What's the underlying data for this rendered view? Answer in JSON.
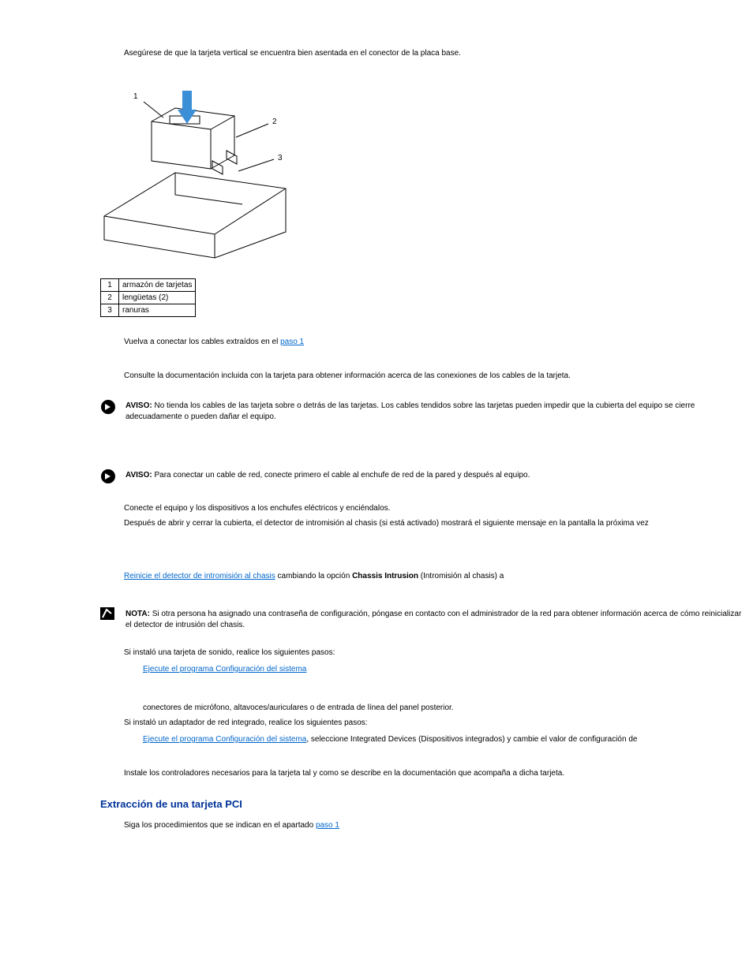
{
  "step_asegurese": "Asegúrese de que la tarjeta vertical se encuentra bien asentada en el conector de la placa base.",
  "diagram_labels": {
    "n1": "1",
    "n2": "2",
    "n3": "3"
  },
  "callouts": {
    "r1": {
      "num": "1",
      "label": "armazón de tarjetas"
    },
    "r2": {
      "num": "2",
      "label": "lengüetas (2)"
    },
    "r3": {
      "num": "3",
      "label": "ranuras"
    }
  },
  "reconnect": {
    "pre": "Vuelva a conectar los cables extraídos en el ",
    "link": "paso 1"
  },
  "consulte": "Consulte la documentación incluida con la tarjeta para obtener información acerca de las conexiones de los cables de la tarjeta.",
  "aviso1": {
    "lead": "AVISO: ",
    "text": "No tienda los cables de las tarjeta sobre o detrás de las tarjetas. Los cables tendidos sobre las tarjetas pueden impedir que la cubierta del equipo se cierre adecuadamente o pueden dañar el equipo."
  },
  "aviso2": {
    "lead": "AVISO: ",
    "text": "Para conectar un cable de red, conecte primero el cable al enchufe de red de la pared y después al equipo."
  },
  "conecte": "Conecte el equipo y los dispositivos a los enchufes eléctricos y enciéndalos.",
  "intromision": "Después de abrir y cerrar la cubierta, el detector de intromisión al chasis (si está activado) mostrará el siguiente mensaje en la pantalla la próxima vez",
  "reinicie": {
    "link": "Reinicie el detector de intromisión al chasis",
    "mid": " cambiando la opción ",
    "opt": "Chassis Intrusion",
    "mid2": " (Intromisión al chasis) a ",
    "val": "",
    "after": ""
  },
  "nota": {
    "lead": "NOTA: ",
    "text": "Si otra persona ha asignado una contraseña de configuración, póngase en contacto con el administrador de la red para obtener información acerca de cómo reinicializar el detector de intrusión del chasis."
  },
  "sonido_intro": "Si instaló una tarjeta de sonido, realice los siguientes pasos:",
  "ejecute_link": "Ejecute el programa Configuración del sistema",
  "sonido_b": "conectores de micrófono, altavoces/auriculares o de entrada de línea del panel posterior.",
  "red_intro": "Si instaló un adaptador de red integrado, realice los siguientes pasos:",
  "red_a": ", seleccione Integrated Devices (Dispositivos integrados) y cambie el valor de configuración de",
  "instale": "Instale los controladores necesarios para la tarjeta tal y como se describe en la documentación que acompaña a dicha tarjeta.",
  "heading_extraccion": "Extracción de una tarjeta PCI",
  "extraccion_step": {
    "pre": "Siga los procedimientos que se indican en el apartado ",
    "pre2": "",
    "link": "paso 1"
  }
}
